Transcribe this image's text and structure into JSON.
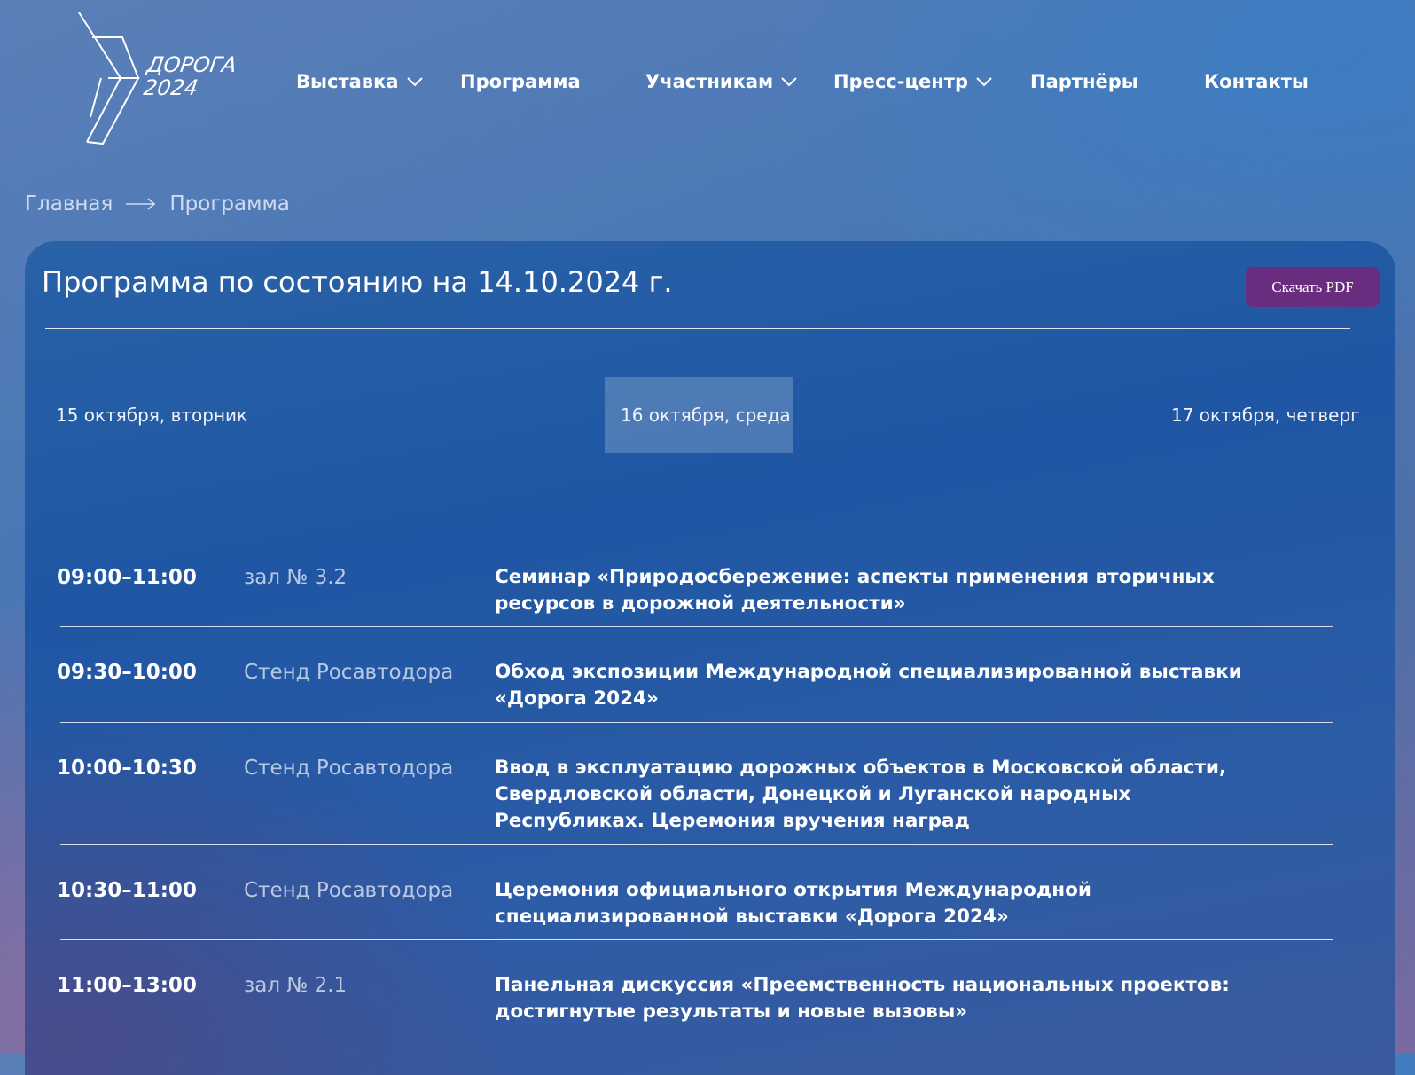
{
  "header": {
    "logo_line1": "ДОРОГА",
    "logo_line2": "2024",
    "nav": [
      {
        "label": "Выставка",
        "has_dropdown": true
      },
      {
        "label": "Программа",
        "has_dropdown": false
      },
      {
        "label": "Участникам",
        "has_dropdown": true
      },
      {
        "label": "Пресс-центр",
        "has_dropdown": true
      },
      {
        "label": "Партнёры",
        "has_dropdown": false
      },
      {
        "label": "Контакты",
        "has_dropdown": false
      }
    ]
  },
  "breadcrumb": {
    "home": "Главная",
    "current": "Программа"
  },
  "program": {
    "title": "Программа по состоянию на 14.10.2024 г.",
    "pdf_button": "Скачать PDF",
    "days": [
      {
        "label": "15 октября, вторник",
        "active": false
      },
      {
        "label": "16 октября, среда",
        "active": true
      },
      {
        "label": "17 октября, четверг",
        "active": false
      }
    ],
    "events": [
      {
        "time": "09:00–11:00",
        "place": "зал № 3.2",
        "title": "Семинар «Природосбережение: аспекты применения вторичных ресурсов в дорожной деятельности»"
      },
      {
        "time": "09:30–10:00",
        "place": "Стенд Росавтодора",
        "title": "Обход экспозиции Международной специализированной выставки «Дорога 2024»"
      },
      {
        "time": "10:00–10:30",
        "place": "Стенд Росавтодора",
        "title": "Ввод в эксплуатацию дорожных объектов в Московской области, Свердловской области, Донецкой и Луганской народных Республиках. Церемония вручения наград"
      },
      {
        "time": "10:30–11:00",
        "place": "Стенд Росавтодора",
        "title": "Церемония официального открытия Международной специализированной выставки «Дорога 2024»"
      },
      {
        "time": "11:00–13:00",
        "place": "зал № 2.1",
        "title": "Панельная дискуссия «Преемственность национальных проектов: достигнутые результаты и новые вызовы»"
      }
    ]
  },
  "colors": {
    "pdf_button": "#6a2c7f",
    "card": "#1f56a3"
  }
}
